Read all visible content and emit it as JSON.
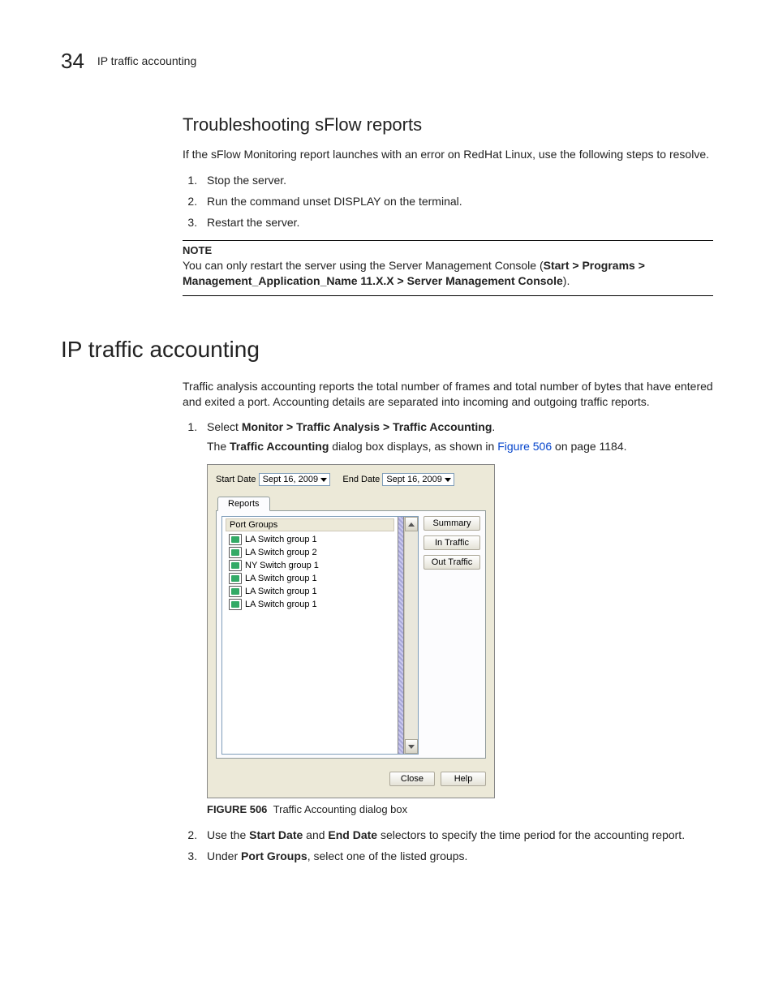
{
  "header": {
    "chapter_number": "34",
    "chapter_title": "IP traffic accounting"
  },
  "section1": {
    "heading": "Troubleshooting sFlow reports",
    "intro": "If the sFlow Monitoring report launches with an error on RedHat Linux, use the following steps to resolve.",
    "steps": {
      "s1": "Stop the server.",
      "s2": "Run the command unset DISPLAY on the terminal.",
      "s3": "Restart the server."
    },
    "note_label": "NOTE",
    "note_text_a": "You can only restart the server using the Server Management Console (",
    "note_bold": "Start > Programs > Management_Application_Name 11.X.X > Server Management Console",
    "note_text_b": ")."
  },
  "section2": {
    "heading": "IP traffic accounting",
    "para": "Traffic analysis accounting reports the total number of frames and total number of bytes that have entered and exited a port. Accounting details are separated into incoming and outgoing traffic reports.",
    "step1_a": "Select ",
    "step1_bold": "Monitor > Traffic Analysis > Traffic Accounting",
    "step1_b": ".",
    "step1_sub_a": "The ",
    "step1_sub_bold": "Traffic Accounting",
    "step1_sub_b": " dialog box displays, as shown in ",
    "step1_sub_link": "Figure 506",
    "step1_sub_c": " on page 1184.",
    "step2_a": "Use the ",
    "step2_b1": "Start Date",
    "step2_b": " and ",
    "step2_b2": "End Date",
    "step2_c": " selectors to specify the time period for the accounting report.",
    "step3_a": "Under ",
    "step3_bold": "Port Groups",
    "step3_b": ", select one of the listed groups.",
    "fig_label": "FIGURE 506",
    "fig_caption": "Traffic Accounting dialog box"
  },
  "dialog": {
    "start_label": "Start Date",
    "start_value": "Sept 16, 2009",
    "end_label": "End Date",
    "end_value": "Sept 16, 2009",
    "tab": "Reports",
    "list_header": "Port Groups",
    "items": {
      "i0": "LA Switch group 1",
      "i1": "LA Switch group 2",
      "i2": "NY Switch group 1",
      "i3": "LA Switch group 1",
      "i4": "LA Switch group 1",
      "i5": "LA Switch group 1"
    },
    "btn_summary": "Summary",
    "btn_in": "In Traffic",
    "btn_out": "Out Traffic",
    "btn_close": "Close",
    "btn_help": "Help"
  }
}
